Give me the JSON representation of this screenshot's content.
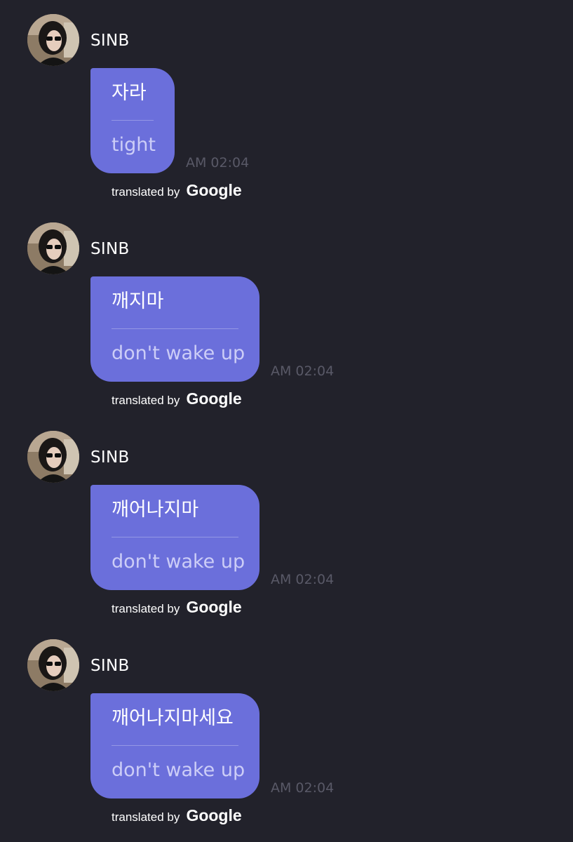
{
  "messages": [
    {
      "sender": "SINB",
      "original": "자라",
      "translation": "tight",
      "time": "AM 02:04",
      "attribution_prefix": "translated by",
      "attribution_brand": "Google"
    },
    {
      "sender": "SINB",
      "original": "깨지마",
      "translation": "don't wake up",
      "time": "AM 02:04",
      "attribution_prefix": "translated by",
      "attribution_brand": "Google"
    },
    {
      "sender": "SINB",
      "original": "깨어나지마",
      "translation": "don't wake up",
      "time": "AM 02:04",
      "attribution_prefix": "translated by",
      "attribution_brand": "Google"
    },
    {
      "sender": "SINB",
      "original": "깨어나지마세요",
      "translation": "don't wake up",
      "time": "AM 02:04",
      "attribution_prefix": "translated by",
      "attribution_brand": "Google"
    }
  ],
  "colors": {
    "background": "#22222b",
    "bubble": "#6b6fdb",
    "timestamp": "#595967"
  },
  "icons": {
    "avatar": "profile-photo"
  }
}
